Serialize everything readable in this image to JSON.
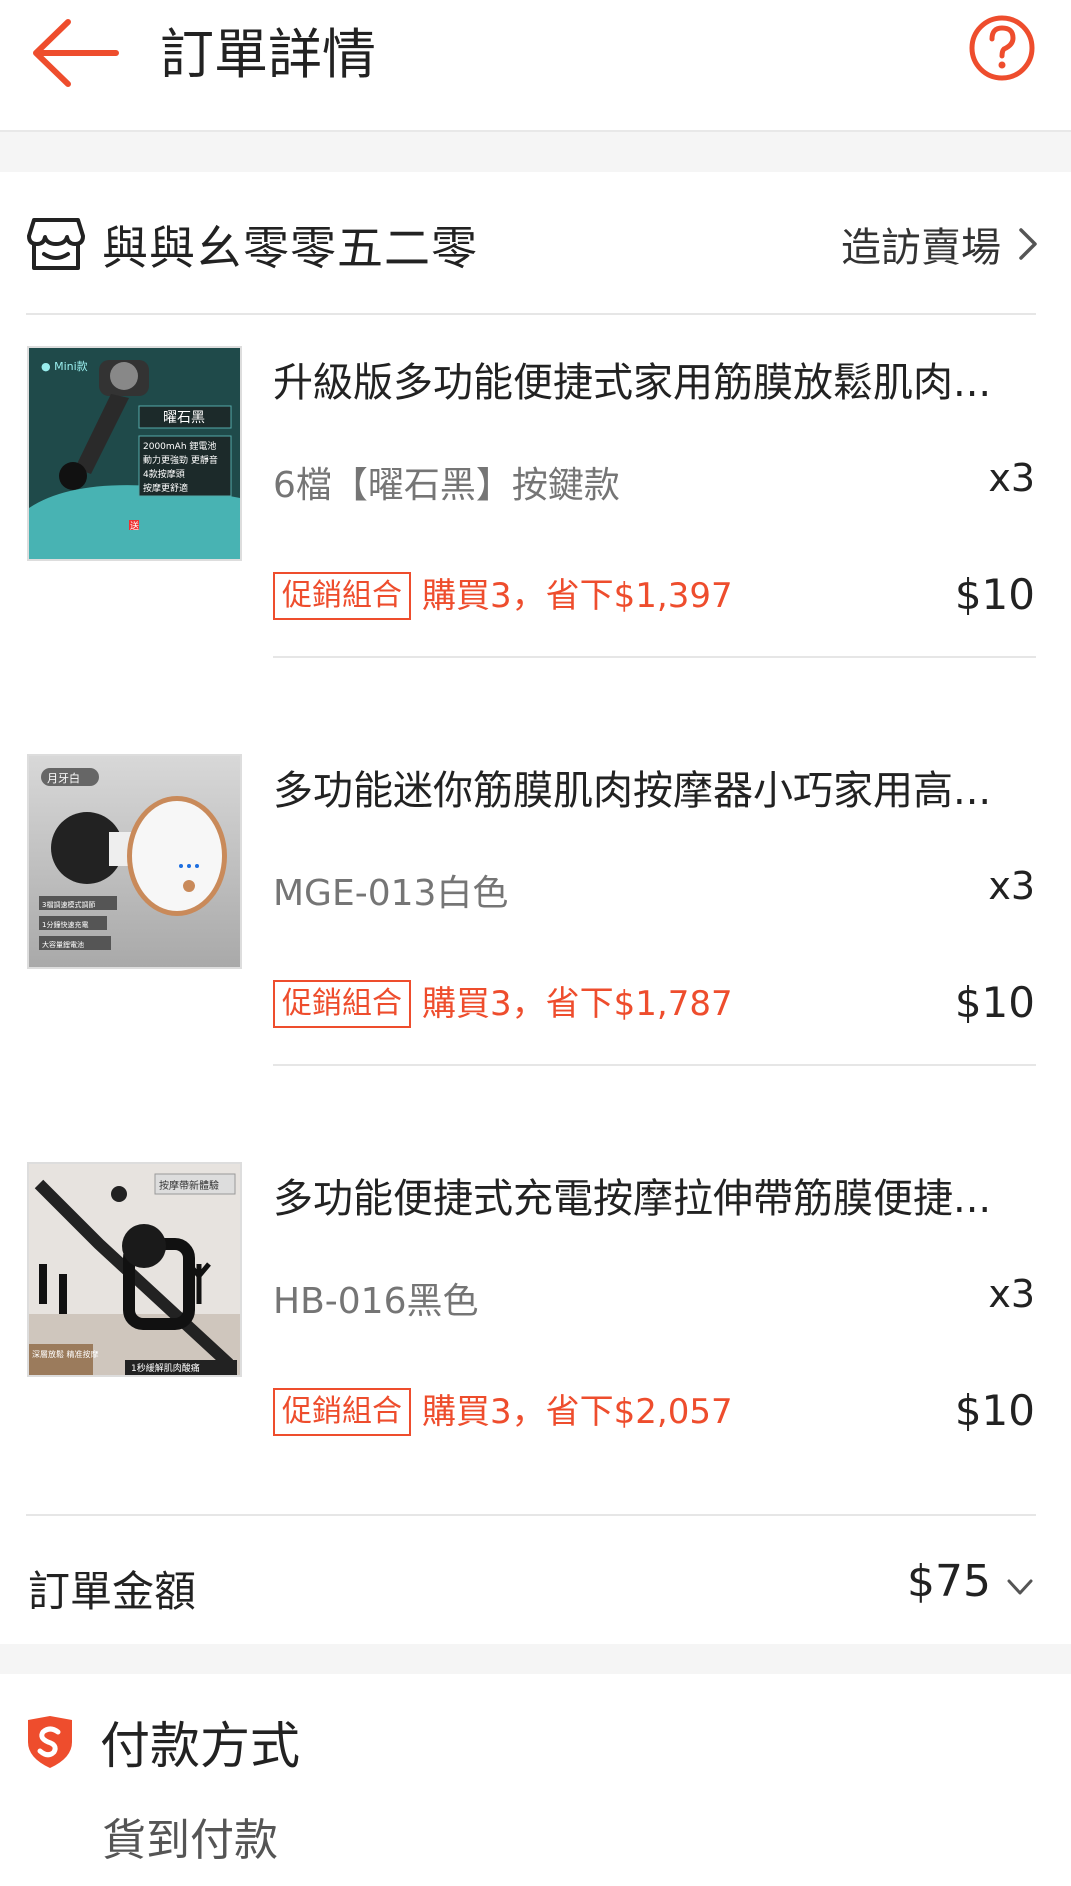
{
  "header": {
    "title": "訂單詳情"
  },
  "shop": {
    "name": "與與幺零零五二零",
    "visit_label": "造訪賣場"
  },
  "items": [
    {
      "name": "升級版多功能便捷式家用筋膜放鬆肌肉...",
      "variant": "6檔【曜石黑】按鍵款",
      "qty": "x3",
      "promo_tag": "促銷組合",
      "promo_text": "購買3，省下$1,397",
      "price": "$10",
      "thumb": {
        "brand": "● Mini款",
        "color_name": "曜石黑",
        "features": [
          "2000mAh 鋰電池",
          "動力更強勁 更靜音",
          "4款按摩頭",
          "按摩更舒適"
        ],
        "gift": "送"
      }
    },
    {
      "name": "多功能迷你筋膜肌肉按摩器小巧家用高...",
      "variant": "MGE-013白色",
      "qty": "x3",
      "promo_tag": "促銷組合",
      "promo_text": "購買3，省下$1,787",
      "price": "$10",
      "thumb": {
        "color_name": "月牙白",
        "features": [
          "3檔調速模式調節",
          "1分鐘快速充電",
          "大容量鋰電池"
        ]
      }
    },
    {
      "name": "多功能便捷式充電按摩拉伸帶筋膜便捷...",
      "variant": "HB-016黑色",
      "qty": "x3",
      "promo_tag": "促銷組合",
      "promo_text": "購買3，省下$2,057",
      "price": "$10",
      "thumb": {
        "headline": "按摩帶新體驗",
        "caption_left": "深層放鬆 精准按摩",
        "caption_right": "1秒緩解肌肉酸痛"
      }
    }
  ],
  "order_total": {
    "label": "訂單金額",
    "value": "$75"
  },
  "payment": {
    "title": "付款方式",
    "method": "貨到付款"
  },
  "colors": {
    "accent": "#ee4d2d"
  }
}
